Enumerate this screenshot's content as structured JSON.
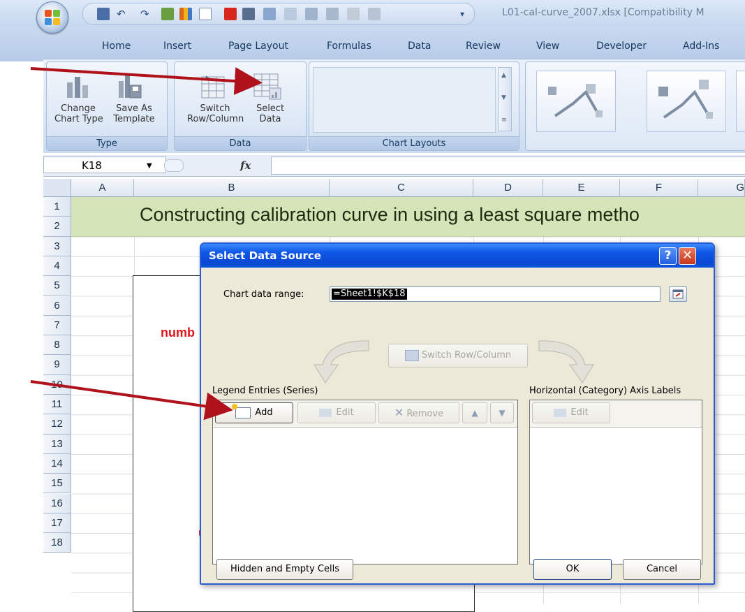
{
  "window": {
    "title": "L01-cal-curve_2007.xlsx  [Compatibility M"
  },
  "ribbon": {
    "tabs": [
      "Home",
      "Insert",
      "Page Layout",
      "Formulas",
      "Data",
      "Review",
      "View",
      "Developer",
      "Add-Ins"
    ],
    "groups": {
      "type": {
        "label": "Type",
        "change_chart_type": [
          "Change",
          "Chart Type"
        ],
        "save_as_template": [
          "Save As",
          "Template"
        ]
      },
      "data": {
        "label": "Data",
        "switch_row_column": [
          "Switch",
          "Row/Column"
        ],
        "select_data": [
          "Select",
          "Data"
        ]
      },
      "chart_layouts": {
        "label": "Chart Layouts"
      }
    }
  },
  "formula_bar": {
    "name_box": "K18",
    "fx": "fx",
    "formula": ""
  },
  "sheet": {
    "columns": [
      "A",
      "B",
      "C",
      "D",
      "E",
      "F",
      "G"
    ],
    "rows": [
      "1",
      "2",
      "3",
      "4",
      "5",
      "6",
      "7",
      "8",
      "9",
      "10",
      "11",
      "12",
      "13",
      "14",
      "15",
      "16",
      "17",
      "18"
    ],
    "heading": "Constructing calibration curve in  using a least square metho",
    "partial_text_numb": "numb",
    "partial_text_u": "u"
  },
  "dialog": {
    "title": "Select Data Source",
    "chart_data_range_label": "Chart data range:",
    "chart_data_range_value": "=Sheet1!$K$18",
    "switch_button": "Switch Row/Column",
    "legend_entries_label": "Legend Entries (Series)",
    "axis_labels_label": "Horizontal (Category) Axis Labels",
    "add_button": "Add",
    "edit_button": "Edit",
    "remove_button": "Remove",
    "axis_edit_button": "Edit",
    "hidden_empty_button": "Hidden and Empty Cells",
    "ok_button": "OK",
    "cancel_button": "Cancel",
    "help_glyph": "?",
    "close_glyph": "✕"
  },
  "colors": {
    "annotation_arrow": "#b0121b",
    "dialog_title_blue": "#0a48d3",
    "row1_band": "#d5e5b8",
    "red_text": "#e0141c"
  }
}
